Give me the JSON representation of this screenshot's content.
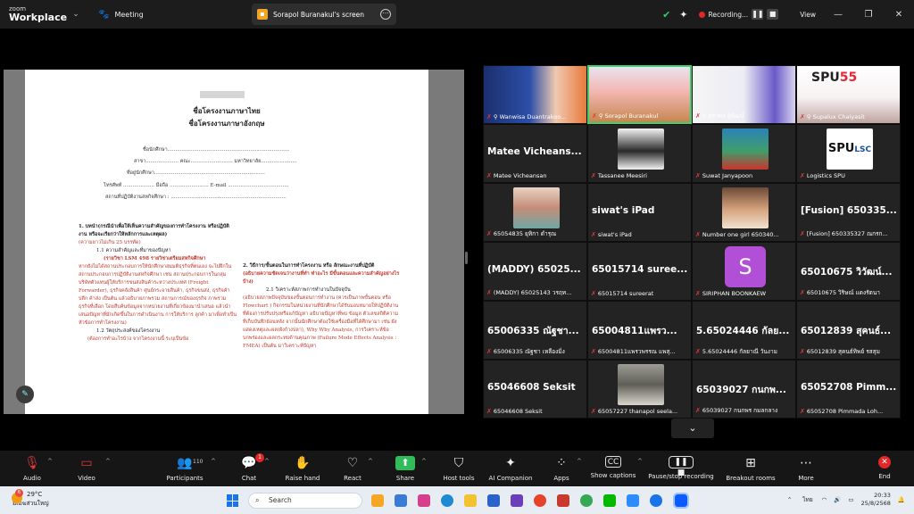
{
  "topbar": {
    "brand_small": "zoom",
    "brand_large": "Workplace",
    "meeting_label": "Meeting",
    "share_tab_label": "Sorapol Buranakul's screen",
    "recording_label": "Recording...",
    "view_label": "View",
    "colors": {
      "bar": "#1c1c1c",
      "shield": "#2ecc71",
      "record": "#e02828"
    }
  },
  "document": {
    "title_th": "ชื่อโครงงานภาษาไทย",
    "title_en": "ชื่อโครงงานภาษาอังกฤษ",
    "field_student": "ชื่อนักศึกษา..............................................................................",
    "field_major": "สาขา..................... คณะ........................... มหาวิทยาลัย.......................",
    "field_address": "ที่อยู่นักศึกษา.......................................................................",
    "field_phone": "โทรศัพท์ .................... มือถือ ......................... E-mail .......................................",
    "field_workplace": "สถานที่ปฏิบัติงานสหกิจศึกษา : ..........................................................................",
    "section1_heading": "1. บทนำ(กรณีนำเพื่อให้เห็นความสำคัญของการทำโครงงาน หรือปฏิบัติงาน หรือจะเรียกว่าให้หลักการและเหตุผล)",
    "section1_note": "(ความยาวไม่เกิน 25 บรรทัด)",
    "section1_1": "1.1 ความสำคัญและที่มาของปัญหา",
    "section1_course": "(รายวิชา LSM 498 รายวิชาเตรียมสหกิจศึกษา",
    "section1_body": "หากยังไม่ได้สถานประกอบการให้นักศึกษาสมมติธุรกิจที่ตนเอง จะไปฝึกในสถานประกอบการปฏิบัติงานสหกิจศึกษา เช่น สถานประกอบการในกลุ่ม บริษัทตัวแทนผู้ให้บริการขนส่งสินค้าระหว่างประเทศ (Freight Forwarder), ธุรกิจคลังสินค้า ศูนย์กระจายสินค้า, ธุรกิจขนส่ง, ธุรกิจค้าปลีก ค้าส่ง เป็นต้น แล้วอธิบายภาพรวม สถานการณ์ของธุรกิจ ภาพรวมธุรกิจที่เลือก โดยสืบค้นข้อมูลจากหน่วยงานที่เกี่ยวข้องมานำเสนอ แล้วนำเสนอปัญหาที่มักเกิดขึ้นในการดำเนินงาน การให้บริการ ลูกค้า มาเพื่อทำเป็นหัวข้อการทำโครงงาน)",
    "section1_2": "1.2 วัตถุประสงค์ของโครงงาน",
    "section1_2_note": "(ต้องการทำอะไรบ้าง จากโครงงานนี้ ระบุเป็นข้อ",
    "section2_heading": "2. วิธีการ/ขั้นตอนในการทำโครงงาน หรือ ลักษณะงานที่ปฏิบัติ",
    "section2_red": "(อธิบายความชัดเจนว่างานที่ทำ ทำอะไร มีขั้นตอนและความสำคัญอย่างไรบ้าง)",
    "section2_1": "2.1 วิเคราะห์สภาพการทำงานในปัจจุบัน",
    "section2_body": "(อธิบายสภาพปัจจุบันของขั้นตอนการทำงาน (ควรเป็นภาพขั้นตอน หรือ Flowchart ) กิจกรรมในหน่วยงานที่นักศึกษาได้รับมอบหมายให้ปฏิบัติงาน ที่ต้องการปรับปรุงหรือแก้ปัญหา อธิบายปัญหาที่พบ ข้อมูล ตัวเลขสถิติความที่เก็บบันทึกย้อนหลัง จากนั้นนักศึกษาต้องใช้เครื่องมือที่ได้ศึกษามา เช่น ผังแสดงเหตุและผล(ผังก้างปลา), Why Why Analysis, การวิเคราะห์ข้อบกพร่องและผลกระทบด้านคุณภาพ (Failure Mode Effects Analysis : FMEA) เป็นต้น มาวิเคราะห์ปัญหา"
  },
  "gallery": [
    {
      "name": "Wanwisa Duantrakoo...",
      "display": "",
      "pinned": true
    },
    {
      "name": "Sorapol Buranakul",
      "display": "",
      "pinned": true,
      "active": true
    },
    {
      "name": "ธราพล ผู้พัฒน์",
      "display": "",
      "pinned": true
    },
    {
      "name": "Supalux Chaiyasit",
      "display": "",
      "pinned": true
    },
    {
      "name": "Matee Vicheansan",
      "display": "Matee Vicheans..."
    },
    {
      "name": "Tassanee Meesiri",
      "display": ""
    },
    {
      "name": "Suwat Janyapoon",
      "display": ""
    },
    {
      "name": "Logistics SPU",
      "display": ""
    },
    {
      "name": "65054835 ยุทิกา ดำรุณ",
      "display": ""
    },
    {
      "name": "siwat's iPad",
      "display": "siwat's iPad"
    },
    {
      "name": "Number one girl 650340...",
      "display": ""
    },
    {
      "name": "[Fusion] 650335327 ณกรก...",
      "display": "[Fusion] 650335..."
    },
    {
      "name": "(MADDY) 65025143 วรฤท...",
      "display": "(MADDY) 65025..."
    },
    {
      "name": "65015714 sureerat",
      "display": "65015714 suree..."
    },
    {
      "name": "SIRIPHAN BOONKAEW",
      "display": ""
    },
    {
      "name": "65010675 วิริษณ์ แดงรัตนา",
      "display": "65010675 วิวัฒน์..."
    },
    {
      "name": "65006335 ณัฐชา เหลืองมิ่ง",
      "display": "65006335 ณัฐชา..."
    },
    {
      "name": "65004811แพรวพรรณ แพสุ...",
      "display": "65004811แพรว..."
    },
    {
      "name": "5.65024446 กัลยาณี วันงาม",
      "display": "5.65024446 กัลย..."
    },
    {
      "name": "65012839 สุคนธ์ทิพย์ รสสุม",
      "display": "65012839 สุคนธ์..."
    },
    {
      "name": "65046608 Seksit",
      "display": "65046608 Seksit"
    },
    {
      "name": "65057227 thanapol seela...",
      "display": ""
    },
    {
      "name": "65039027 กนกพร กมลกลาง",
      "display": "65039027 กนกพ..."
    },
    {
      "name": "65052708 Pimmada Loh...",
      "display": "65052708 Pimm..."
    }
  ],
  "toolbar": {
    "audio": "Audio",
    "video": "Video",
    "participants": "Participants",
    "participants_count": "110",
    "chat": "Chat",
    "chat_badge": "1",
    "raise_hand": "Raise hand",
    "react": "React",
    "share": "Share",
    "host_tools": "Host tools",
    "ai_companion": "AI Companion",
    "apps": "Apps",
    "show_captions": "Show captions",
    "pause_recording": "Pause/stop recording",
    "breakout_rooms": "Breakout rooms",
    "more": "More",
    "end": "End"
  },
  "taskbar": {
    "weather_temp": "29°C",
    "weather_text": "มีเมฆส่วนใหญ่",
    "weather_badge": "6",
    "search_placeholder": "Search",
    "language": "ไทย",
    "time": "20:33",
    "date": "25/8/2568"
  }
}
